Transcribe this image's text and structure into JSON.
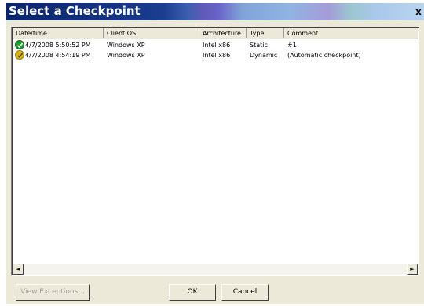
{
  "window": {
    "title": "Select a Checkpoint",
    "close_glyph": "x"
  },
  "table": {
    "columns": [
      "Date/time",
      "Client OS",
      "Architecture",
      "Type",
      "Comment"
    ],
    "rows": [
      {
        "status_icon": "check-icon",
        "datetime": "4/7/2008 5:50:52 PM",
        "client_os": "Windows XP",
        "architecture": "Intel x86",
        "type": "Static",
        "comment": "#1"
      },
      {
        "status_icon": "warning-icon",
        "datetime": "4/7/2008 4:54:19 PM",
        "client_os": "Windows XP",
        "architecture": "Intel x86",
        "type": "Dynamic",
        "comment": "(Automatic checkpoint)"
      }
    ]
  },
  "scrollbar": {
    "left_glyph": "◄",
    "right_glyph": "►"
  },
  "buttons": {
    "view_exceptions": "View Exceptions...",
    "ok": "OK",
    "cancel": "Cancel"
  },
  "colors": {
    "ok_icon": "#1e9b2e",
    "warn_icon": "#d9b420",
    "dialog_bg": "#ece9d8"
  }
}
